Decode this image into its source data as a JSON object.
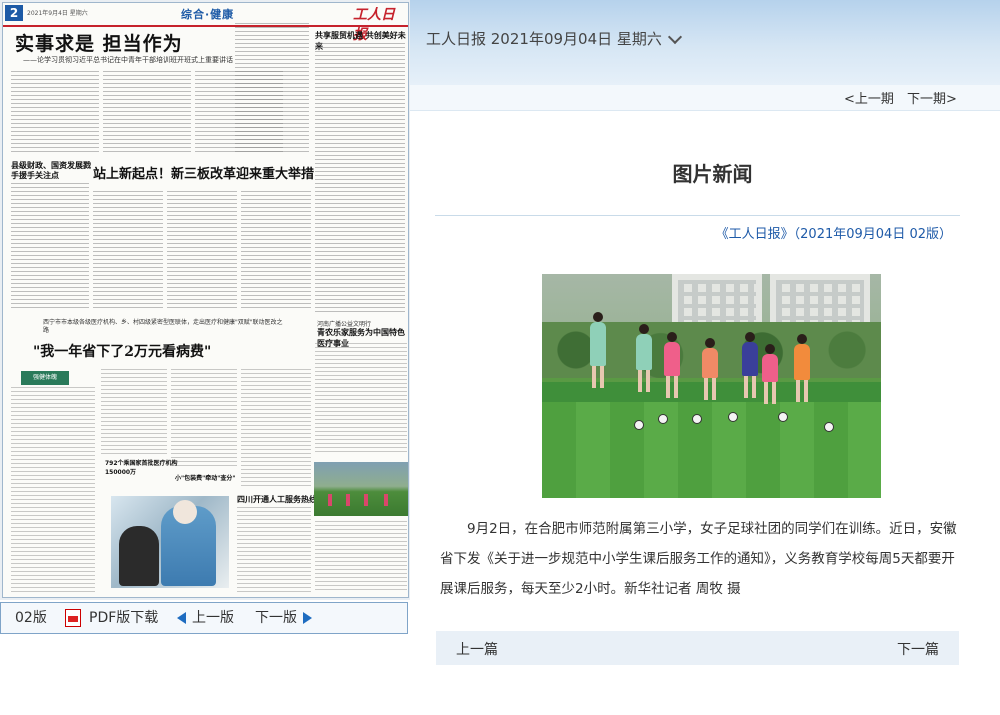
{
  "paper": {
    "page_number": "2",
    "date": "2021年9月4日  星期六",
    "section": "综合·健康",
    "logo": "工人日报",
    "headline_main": "实事求是  担当作为",
    "headline_main_sub": "——论学习贯彻习近平总书记在中青年干部培训班开班式上重要讲话",
    "headline_side": "共享服贸机遇  共创美好未来",
    "headline_left_mid": "县级财政、国资发展戮手援手关注点",
    "headline_mid": "站上新起点！新三板改革迎来重大举措",
    "headline_lower_sub": "西宁市市本级各级医疗机构、乡、村四级紧密型医联体，走出医疗和健康\"双赋\"联动医改之路",
    "headline_lower": "\"我一年省下了2万元看病费\"",
    "headline_right_small": "河南广播公益文明行",
    "headline_right": "青农乐家服务为中国特色医疗事业",
    "headline_bottom": "四川开通人工服务热线",
    "box_label": "强健体魄",
    "caption_a": "792个乘国家首批医疗机构150000万",
    "caption_b": "小\"包装费\"牵动\"查分\""
  },
  "toolbar": {
    "page_label": "02版",
    "pdf_label": "PDF版下载",
    "prev_page_label": "上一版",
    "next_page_label": "下一版"
  },
  "viewer": {
    "title": "工人日报 2021年09月04日 星期六",
    "prev_edition": "<上一期",
    "next_edition": "下一期>"
  },
  "article": {
    "title": "图片新闻",
    "source": "《工人日报》（2021年09月04日 02版）",
    "body": "9月2日，在合肥市师范附属第三小学，女子足球社团的同学们在训练。近日，安徽省下发《关于进一步规范中小学生课后服务工作的通知》，义务教育学校每周5天都要开展课后服务，每天至少2小时。新华社记者 周牧 摄"
  },
  "pager": {
    "prev_label": "上一篇",
    "next_label": "下一篇"
  },
  "colors": {
    "accent_blue": "#1e5aa8",
    "header_gradient_top": "#b6d2ec",
    "paper_red": "#c6222c"
  }
}
